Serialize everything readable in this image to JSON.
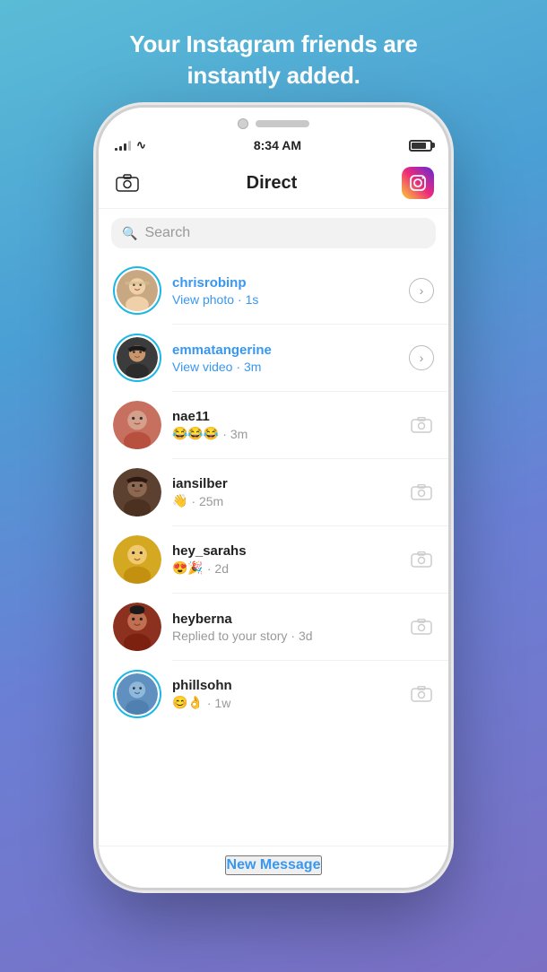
{
  "header": {
    "title": "Your Instagram friends are\ninstantly added.",
    "line1": "Your Instagram friends are",
    "line2": "instantly added."
  },
  "status_bar": {
    "time": "8:34 AM"
  },
  "app": {
    "title": "Direct",
    "search_placeholder": "Search",
    "new_message": "New Message"
  },
  "conversations": [
    {
      "id": "chrisrobinp",
      "name": "chrisrobinp",
      "preview": "View photo",
      "time": "1s",
      "has_story": true,
      "name_blue": true,
      "preview_blue": true,
      "action": "arrow",
      "avatar_color": "#c8a882"
    },
    {
      "id": "emmatangerine",
      "name": "emmatangerine",
      "preview": "View video",
      "time": "3m",
      "has_story": true,
      "name_blue": true,
      "preview_blue": true,
      "action": "arrow",
      "avatar_color": "#3c3c3c"
    },
    {
      "id": "nae11",
      "name": "nae11",
      "preview": "😂😂😂",
      "time": "3m",
      "has_story": false,
      "name_blue": false,
      "preview_blue": false,
      "action": "camera",
      "avatar_color": "#c87060"
    },
    {
      "id": "iansilber",
      "name": "iansilber",
      "preview": "👋",
      "time": "25m",
      "has_story": false,
      "name_blue": false,
      "preview_blue": false,
      "action": "camera",
      "avatar_color": "#5c4030"
    },
    {
      "id": "hey_sarahs",
      "name": "hey_sarahs",
      "preview": "😍🎉",
      "time": "2d",
      "has_story": false,
      "name_blue": false,
      "preview_blue": false,
      "action": "camera",
      "avatar_color": "#d4a820"
    },
    {
      "id": "heyberna",
      "name": "heyberna",
      "preview": "Replied to your story",
      "time": "3d",
      "has_story": false,
      "name_blue": false,
      "preview_blue": false,
      "action": "camera",
      "avatar_color": "#8c3020"
    },
    {
      "id": "phillsohn",
      "name": "phillsohn",
      "preview": "😊👌",
      "time": "1w",
      "has_story": false,
      "name_blue": false,
      "preview_blue": false,
      "action": "camera",
      "avatar_color": "#6090c0"
    }
  ]
}
